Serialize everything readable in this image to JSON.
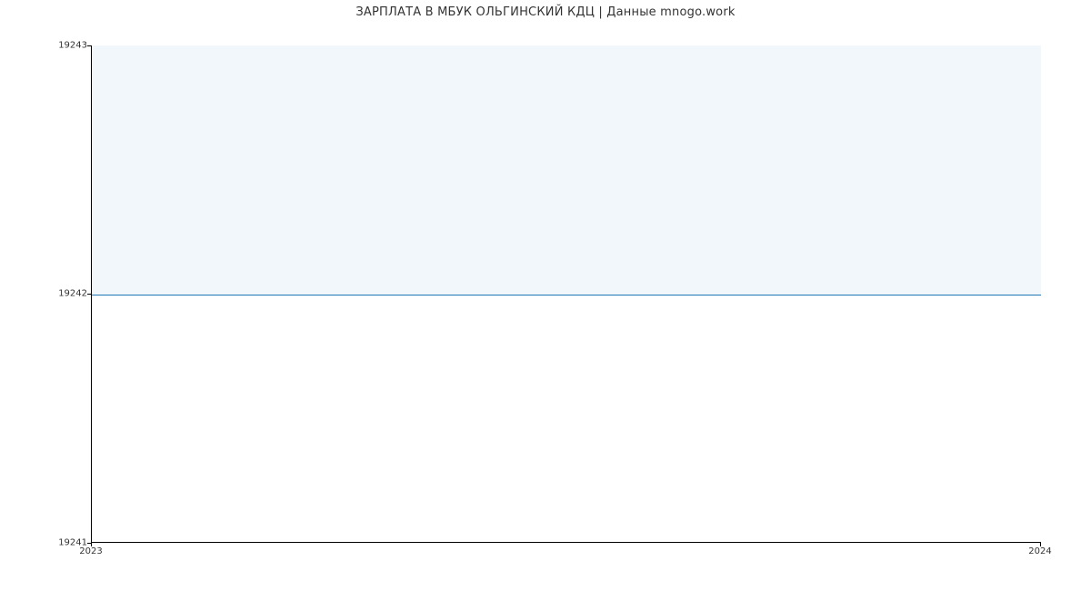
{
  "chart_data": {
    "type": "area",
    "title": "ЗАРПЛАТА В МБУК ОЛЬГИНСКИЙ КДЦ | Данные mnogo.work",
    "xlabel": "",
    "ylabel": "",
    "x": [
      2023,
      2024
    ],
    "values": [
      19242,
      19242
    ],
    "xlim": [
      2023,
      2024
    ],
    "ylim": [
      19241,
      19243
    ],
    "yticks": [
      19241,
      19242,
      19243
    ],
    "xticks": [
      2023,
      2024
    ],
    "grid": false,
    "legend": false,
    "fill_to_top": true,
    "colors": {
      "line": "#1f77b4",
      "fill": "rgba(31,119,180,0.06)"
    }
  },
  "ytick_labels": {
    "0": "19241",
    "1": "19242",
    "2": "19243"
  },
  "xtick_labels": {
    "0": "2023",
    "1": "2024"
  }
}
